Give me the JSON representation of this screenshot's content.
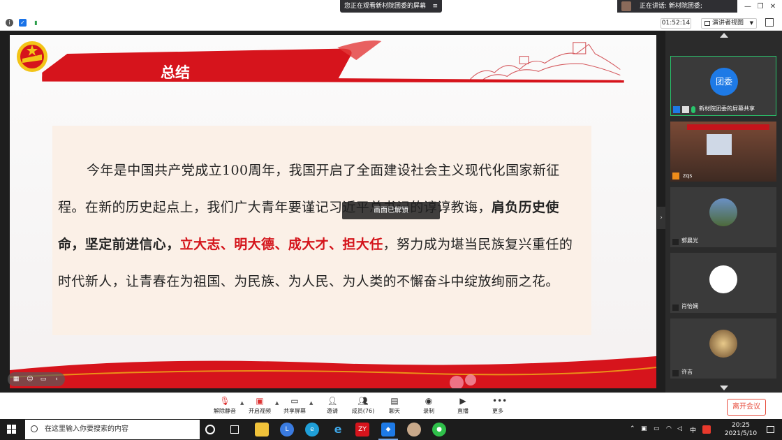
{
  "titlebar": {
    "viewing_banner": "您正在观看新材院团委的屏幕",
    "speaking_banner": "正在讲话: 新材院团委;"
  },
  "toprow": {
    "timer": "01:52:14",
    "view_mode": "演讲者视图"
  },
  "slide": {
    "title": "总结",
    "paragraph_plain_1": "今年是中国共产党成立100周年，我国开启了全面建设社会主义现代化国家新征程。在新的历史起点上，我们广大青年要谨记习近平总书记的谆谆教诲，",
    "paragraph_bold": "肩负历史使命，坚定前进信心，",
    "paragraph_red": "立大志、明大德、成大才、担大任",
    "paragraph_plain_2": "，努力成为堪当民族复兴重任的时代新人，让青春在为祖国、为民族、为人民、为人类的不懈奋斗中绽放绚丽之花。"
  },
  "toast": "画面已解锁",
  "participants": [
    {
      "name": "新材院团委的屏幕共享",
      "avatar_text": "团委"
    },
    {
      "name": "zqs"
    },
    {
      "name": "郭晨光"
    },
    {
      "name": "肖怡娴"
    },
    {
      "name": "许吉"
    }
  ],
  "meetbar": {
    "unmute": "解除静音",
    "start_video": "开启视频",
    "share_screen": "共享屏幕",
    "invite": "邀请",
    "members": "成员(76)",
    "chat": "聊天",
    "record": "录制",
    "live": "直播",
    "more": "更多",
    "leave": "离开会议"
  },
  "taskbar": {
    "search_placeholder": "在这里输入你要搜索的内容",
    "time": "20:25",
    "date": "2021/5/10",
    "ime": "中",
    "zy_label": "ZY"
  },
  "colors": {
    "party_red": "#d4141b",
    "leave_red": "#e74c3c",
    "active_green": "#29c46b"
  }
}
